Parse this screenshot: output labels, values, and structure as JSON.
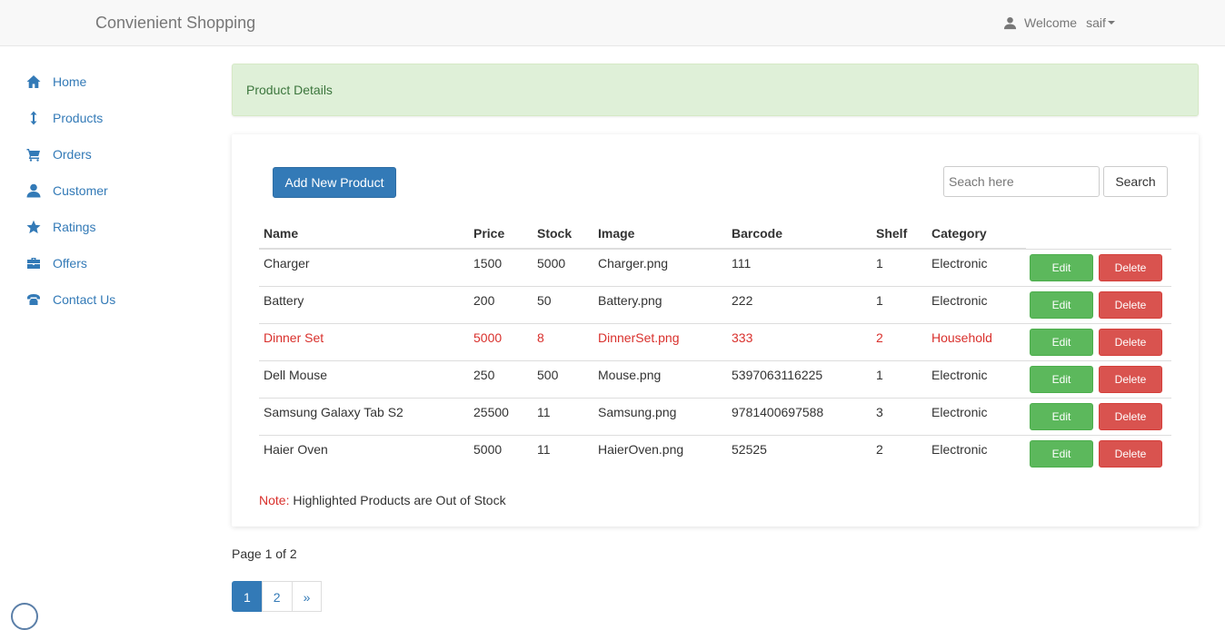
{
  "header": {
    "brand": "Convienient Shopping",
    "welcome": "Welcome",
    "user": "saif"
  },
  "sidebar": {
    "items": [
      {
        "label": "Home",
        "icon": "home-icon"
      },
      {
        "label": "Products",
        "icon": "vertical-arrows-icon"
      },
      {
        "label": "Orders",
        "icon": "shopping-cart-icon"
      },
      {
        "label": "Customer",
        "icon": "user-icon"
      },
      {
        "label": "Ratings",
        "icon": "star-icon"
      },
      {
        "label": "Offers",
        "icon": "briefcase-icon"
      },
      {
        "label": "Contact Us",
        "icon": "phone-icon"
      }
    ]
  },
  "alert": {
    "text": "Product Details"
  },
  "toolbar": {
    "add_label": "Add New Product",
    "search_placeholder": "Seach here",
    "search_label": "Search"
  },
  "table": {
    "headers": [
      "Name",
      "Price",
      "Stock",
      "Image",
      "Barcode",
      "Shelf",
      "Category"
    ],
    "edit_label": "Edit",
    "delete_label": "Delete",
    "rows": [
      {
        "name": "Charger",
        "price": "1500",
        "stock": "5000",
        "image": "Charger.png",
        "barcode": "111",
        "shelf": "1",
        "category": "Electronic",
        "out_of_stock": false
      },
      {
        "name": "Battery",
        "price": "200",
        "stock": "50",
        "image": "Battery.png",
        "barcode": "222",
        "shelf": "1",
        "category": "Electronic",
        "out_of_stock": false
      },
      {
        "name": "Dinner Set",
        "price": "5000",
        "stock": "8",
        "image": "DinnerSet.png",
        "barcode": "333",
        "shelf": "2",
        "category": "Household",
        "out_of_stock": true
      },
      {
        "name": "Dell Mouse",
        "price": "250",
        "stock": "500",
        "image": "Mouse.png",
        "barcode": "5397063116225",
        "shelf": "1",
        "category": "Electronic",
        "out_of_stock": false
      },
      {
        "name": "Samsung Galaxy Tab S2",
        "price": "25500",
        "stock": "11",
        "image": "Samsung.png",
        "barcode": "9781400697588",
        "shelf": "3",
        "category": "Electronic",
        "out_of_stock": false
      },
      {
        "name": "Haier Oven",
        "price": "5000",
        "stock": "11",
        "image": "HaierOven.png",
        "barcode": "52525",
        "shelf": "2",
        "category": "Electronic",
        "out_of_stock": false
      }
    ]
  },
  "note": {
    "label": "Note:",
    "text": " Highlighted Products are Out of Stock"
  },
  "pagination": {
    "info": "Page 1 of 2",
    "pages": [
      "1",
      "2"
    ],
    "next": "»",
    "current": "1"
  },
  "colors": {
    "primary": "#337ab7",
    "success": "#5cb85c",
    "danger": "#d9534f",
    "out_of_stock_text": "#d9302c",
    "alert_bg": "#dff0d8"
  }
}
